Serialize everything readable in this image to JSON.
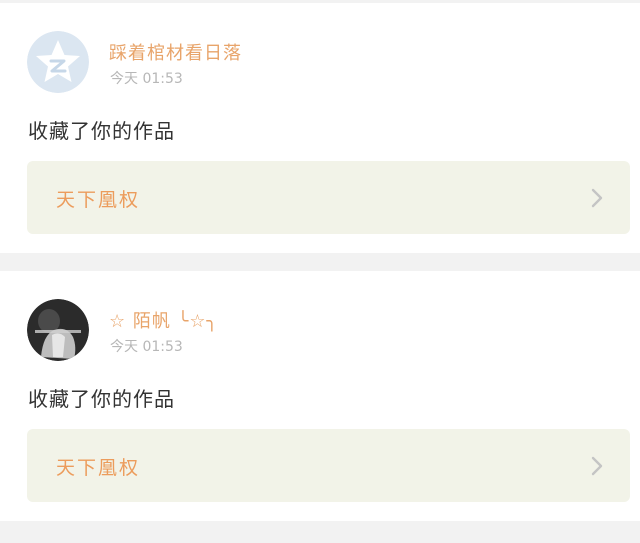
{
  "notifications": [
    {
      "username": "踩着棺材看日落",
      "timestamp": "今天 01:53",
      "action": "收藏了你的作品",
      "work_title": "天下凰权"
    },
    {
      "username": "☆ 陌帆 ╰☆╮",
      "timestamp": "今天 01:53",
      "action": "收藏了你的作品",
      "work_title": "天下凰权"
    }
  ],
  "colors": {
    "username": "#e8a46a",
    "work_title": "#ec9c5c",
    "work_box_bg": "#f2f3e8",
    "timestamp": "#b7b7b7",
    "page_bg": "#f2f2f2"
  },
  "icons": {
    "avatar_1": "qzone-star-avatar",
    "avatar_2": "user-photo-avatar",
    "chevron": "chevron-right-icon"
  }
}
